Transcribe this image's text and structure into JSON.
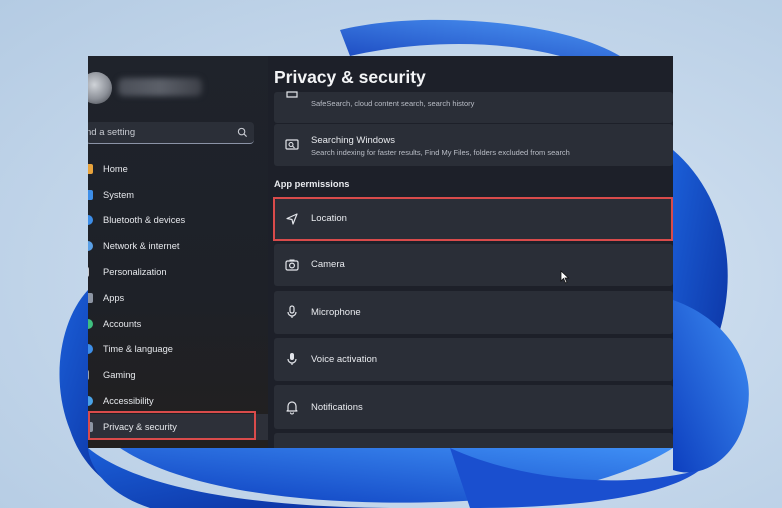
{
  "window": {
    "page_title": "Privacy & security"
  },
  "sidebar": {
    "search_placeholder": "nd a setting",
    "items": [
      {
        "label": "Home",
        "icon": "home-icon",
        "color": "#e8a33c"
      },
      {
        "label": "System",
        "icon": "system-icon",
        "color": "#3d8ee8"
      },
      {
        "label": "Bluetooth & devices",
        "icon": "bluetooth-icon",
        "color": "#3d8ee8"
      },
      {
        "label": "Network & internet",
        "icon": "network-icon",
        "color": "#5aa0e6"
      },
      {
        "label": "Personalization",
        "icon": "brush-icon",
        "color": "#c9cbd0"
      },
      {
        "label": "Apps",
        "icon": "apps-icon",
        "color": "#8d95a3"
      },
      {
        "label": "Accounts",
        "icon": "accounts-icon",
        "color": "#3fbf7f"
      },
      {
        "label": "Time & language",
        "icon": "globe-icon",
        "color": "#3d8ee8"
      },
      {
        "label": "Gaming",
        "icon": "gaming-icon",
        "color": "#9aa1ad"
      },
      {
        "label": "Accessibility",
        "icon": "accessibility-icon",
        "color": "#4aa3e8"
      },
      {
        "label": "Privacy & security",
        "icon": "shield-icon",
        "color": "#8d95a3",
        "selected": true
      }
    ]
  },
  "content": {
    "partial_card": {
      "description": "SafeSearch, cloud content search, search history"
    },
    "searching_windows": {
      "title": "Searching Windows",
      "description": "Search indexing for faster results, Find My Files, folders excluded from search"
    },
    "section_header": "App permissions",
    "permissions": [
      {
        "label": "Location",
        "icon": "location-icon",
        "highlighted": true
      },
      {
        "label": "Camera",
        "icon": "camera-icon"
      },
      {
        "label": "Microphone",
        "icon": "microphone-icon"
      },
      {
        "label": "Voice activation",
        "icon": "voice-activation-icon"
      },
      {
        "label": "Notifications",
        "icon": "bell-icon"
      }
    ]
  },
  "colors": {
    "highlight_border": "#d94b4b",
    "window_bg": "#1d2029",
    "card_bg": "#2a2e37"
  }
}
